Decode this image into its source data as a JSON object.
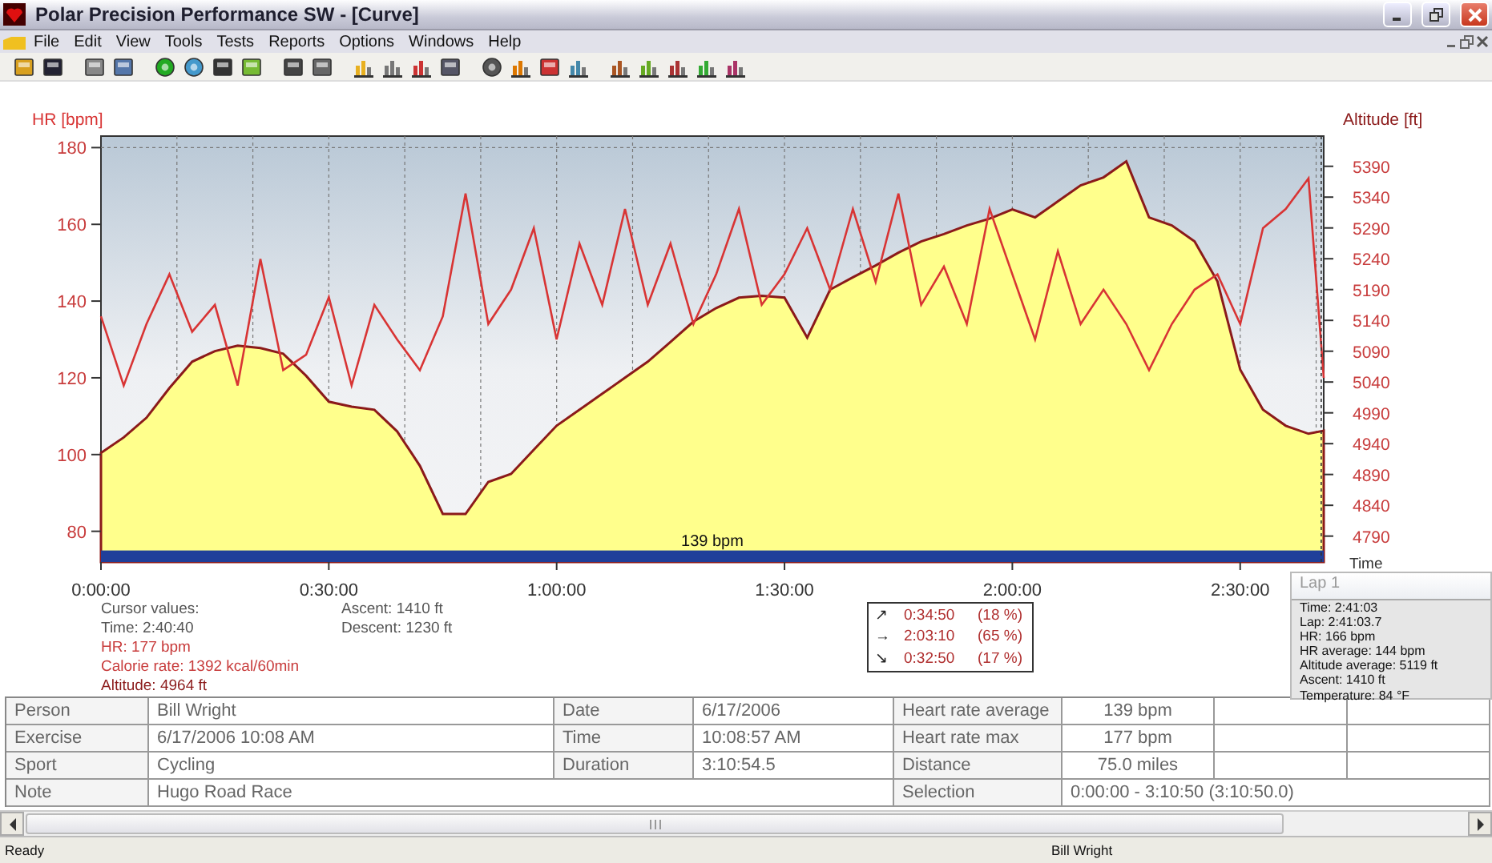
{
  "window": {
    "title": "Polar Precision Performance SW - [Curve]"
  },
  "menu": [
    "File",
    "Edit",
    "View",
    "Tools",
    "Tests",
    "Reports",
    "Options",
    "Windows",
    "Help"
  ],
  "chart": {
    "average_label": "139 bpm",
    "chart_data": {
      "type": "line",
      "xlabel": "Time",
      "grid": true,
      "ref_lines": [
        {
          "axis": "x",
          "value": 160.67
        }
      ],
      "bands": [
        {
          "axis": "y",
          "from": 72,
          "to": 75
        }
      ],
      "xlim": [
        0,
        161
      ],
      "ylim": [
        72,
        183
      ],
      "y2lim": [
        4748,
        5439
      ],
      "xticks": [
        {
          "value": 0,
          "label": "0:00:00"
        },
        {
          "value": 30,
          "label": "0:30:00"
        },
        {
          "value": 60,
          "label": "1:00:00"
        },
        {
          "value": 90,
          "label": "1:30:00"
        },
        {
          "value": 120,
          "label": "2:00:00"
        },
        {
          "value": 150,
          "label": "2:30:00"
        }
      ],
      "yticks": [
        80,
        100,
        120,
        140,
        160,
        180
      ],
      "y2ticks": [
        4790,
        4840,
        4890,
        4940,
        4990,
        5040,
        5090,
        5140,
        5190,
        5240,
        5290,
        5340,
        5390
      ],
      "x": [
        0,
        3,
        6,
        9,
        12,
        15,
        18,
        21,
        24,
        27,
        30,
        33,
        36,
        39,
        42,
        45,
        48,
        51,
        54,
        57,
        60,
        63,
        66,
        69,
        72,
        75,
        78,
        81,
        84,
        87,
        90,
        93,
        96,
        99,
        102,
        105,
        108,
        111,
        114,
        117,
        120,
        123,
        126,
        129,
        132,
        135,
        138,
        141,
        144,
        147,
        150,
        153,
        156,
        159,
        161
      ],
      "series": [
        {
          "name": "HR [bpm]",
          "color": "#d83434",
          "values": [
            136,
            118,
            134,
            147,
            132,
            139,
            118,
            151,
            122,
            126,
            141,
            118,
            139,
            130,
            122,
            136,
            168,
            134,
            143,
            159,
            130,
            155,
            139,
            164,
            139,
            155,
            134,
            147,
            164,
            139,
            147,
            159,
            143,
            164,
            145,
            168,
            139,
            149,
            134,
            164,
            147,
            130,
            153,
            134,
            143,
            134,
            122,
            134,
            143,
            147,
            134,
            159,
            164,
            172,
            120
          ]
        },
        {
          "name": "Altitude [ft]",
          "color": "#8b1a1a",
          "axis": "y2",
          "type": "area",
          "values": [
            4925,
            4950,
            4982,
            5030,
            5073,
            5090,
            5099,
            5095,
            5086,
            5050,
            5008,
            5000,
            4995,
            4960,
            4904,
            4826,
            4826,
            4878,
            4891,
            4930,
            4969,
            4995,
            5021,
            5047,
            5073,
            5105,
            5138,
            5160,
            5177,
            5180,
            5177,
            5112,
            5190,
            5210,
            5229,
            5250,
            5268,
            5280,
            5294,
            5305,
            5320,
            5307,
            5333,
            5359,
            5372,
            5398,
            5307,
            5294,
            5268,
            5203,
            5060,
            4995,
            4969,
            4956,
            4961
          ]
        }
      ]
    }
  },
  "cursor_values": [
    {
      "text": "Cursor values:",
      "color": "#555555"
    },
    {
      "text": "Time: 2:40:40",
      "color": "#555555"
    },
    {
      "text": "HR: 177 bpm",
      "color": "#c83c3c"
    },
    {
      "text": "Calorie rate: 1392 kcal/60min",
      "color": "#c83c3c"
    },
    {
      "text": "Altitude: 4964 ft",
      "color": "#8b1a1a"
    }
  ],
  "ascent_descent": [
    "Ascent: 1410 ft",
    "Descent: 1230 ft"
  ],
  "zones": [
    {
      "icon": "↗",
      "time": "0:34:50",
      "percent": "(18 %)"
    },
    {
      "icon": "→",
      "time": "2:03:10",
      "percent": "(65 %)"
    },
    {
      "icon": "↘",
      "time": "0:32:50",
      "percent": "(17 %)"
    }
  ],
  "lap_popup": {
    "title": "Lap 1",
    "lines": [
      "Time: 2:41:03",
      "Lap: 2:41:03.7",
      "HR: 166 bpm",
      "HR average:  144 bpm",
      "Altitude average:  5119 ft",
      "Ascent:  1410 ft",
      "Temperature: 84 °F"
    ]
  },
  "table": {
    "rows": [
      [
        {
          "text": "Person"
        },
        {
          "text": "Bill Wright"
        },
        {
          "text": "Date"
        },
        {
          "text": "6/17/2006"
        },
        {
          "text": "Heart rate average"
        },
        {
          "text": "139 bpm"
        },
        {
          "text": ""
        },
        {
          "text": ""
        }
      ],
      [
        {
          "text": "Exercise"
        },
        {
          "text": "6/17/2006 10:08 AM"
        },
        {
          "text": "Time"
        },
        {
          "text": "10:08:57 AM"
        },
        {
          "text": "Heart rate max"
        },
        {
          "text": "177 bpm"
        },
        {
          "text": ""
        },
        {
          "text": ""
        }
      ],
      [
        {
          "text": "Sport"
        },
        {
          "text": "Cycling"
        },
        {
          "text": "Duration"
        },
        {
          "text": "3:10:54.5"
        },
        {
          "text": "Distance"
        },
        {
          "text": "75.0 miles"
        },
        {
          "text": ""
        },
        {
          "text": ""
        }
      ],
      [
        {
          "text": "Note"
        },
        {
          "text": "Hugo Road Race"
        },
        {
          "text": ""
        },
        {
          "text": ""
        },
        {
          "text": "Selection"
        },
        {
          "text": "0:00:00 - 3:10:50 (3:10:50.0)"
        },
        {
          "text": ""
        },
        {
          "text": ""
        }
      ]
    ]
  },
  "status_bar": {
    "left": "Ready",
    "right": "Bill Wright"
  }
}
